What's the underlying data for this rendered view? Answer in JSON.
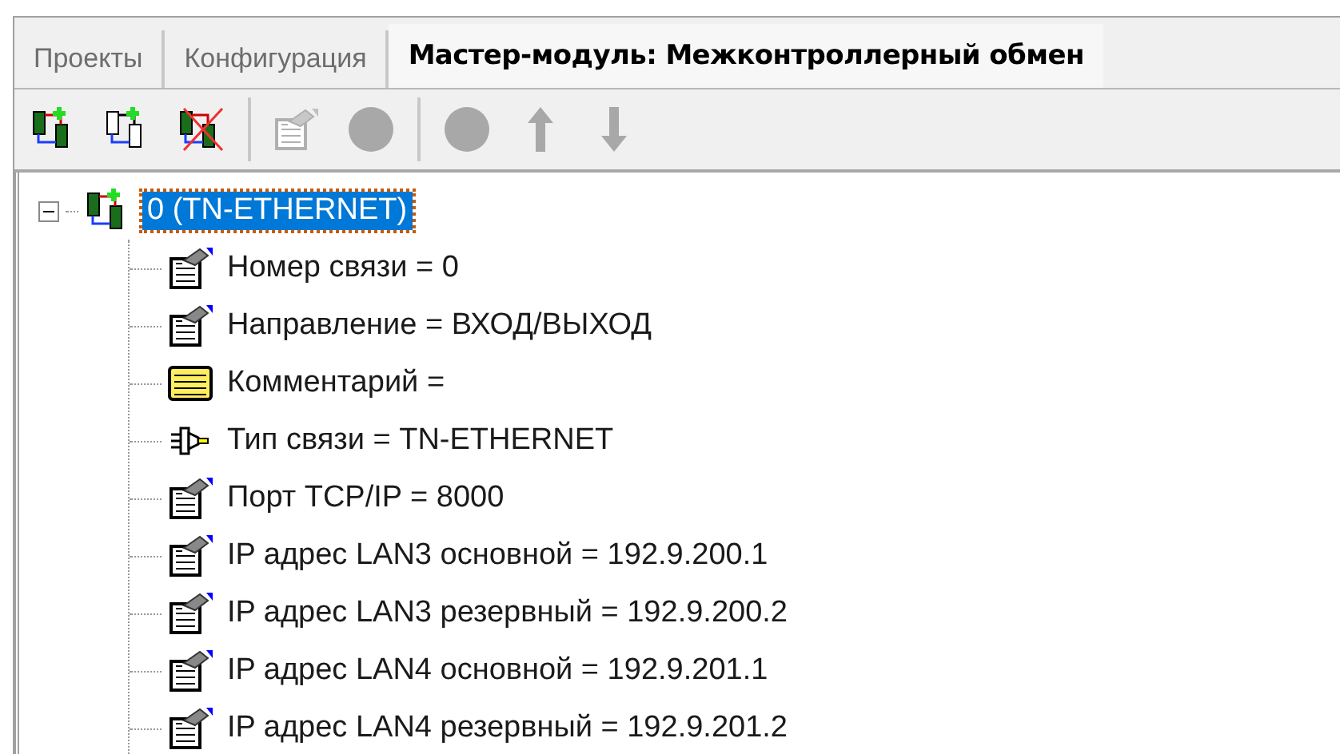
{
  "tabs": [
    {
      "label": "Проекты",
      "selected": false
    },
    {
      "label": "Конфигурация",
      "selected": false
    },
    {
      "label": "Мастер-модуль: Межконтроллерный обмен",
      "selected": true
    }
  ],
  "toolbar": [
    {
      "kind": "add-link",
      "disabled": false
    },
    {
      "kind": "add-link-outline",
      "disabled": false
    },
    {
      "kind": "delete-link",
      "disabled": false
    },
    {
      "kind": "separator"
    },
    {
      "kind": "properties",
      "disabled": true
    },
    {
      "kind": "circle",
      "disabled": true
    },
    {
      "kind": "separator"
    },
    {
      "kind": "circle",
      "disabled": true
    },
    {
      "kind": "up",
      "disabled": true
    },
    {
      "kind": "down",
      "disabled": true
    }
  ],
  "tree": [
    {
      "label": "0 (TN-ETHERNET)",
      "selected": true,
      "expanded": true,
      "children": [
        {
          "kind": "param",
          "label": "Номер связи = 0"
        },
        {
          "kind": "param",
          "label": "Направление = ВХОД/ВЫХОД"
        },
        {
          "kind": "comment",
          "label": "Комментарий ="
        },
        {
          "kind": "plug",
          "label": "Тип связи = TN-ETHERNET"
        },
        {
          "kind": "param",
          "label": "Порт TCP/IP = 8000"
        },
        {
          "kind": "param",
          "label": "IP адрес LAN3 основной = 192.9.200.1"
        },
        {
          "kind": "param",
          "label": "IP адрес LAN3 резервный = 192.9.200.2"
        },
        {
          "kind": "param",
          "label": "IP адрес LAN4 основной = 192.9.201.1"
        },
        {
          "kind": "param",
          "label": "IP адрес LAN4 резервный = 192.9.201.2"
        }
      ]
    }
  ]
}
